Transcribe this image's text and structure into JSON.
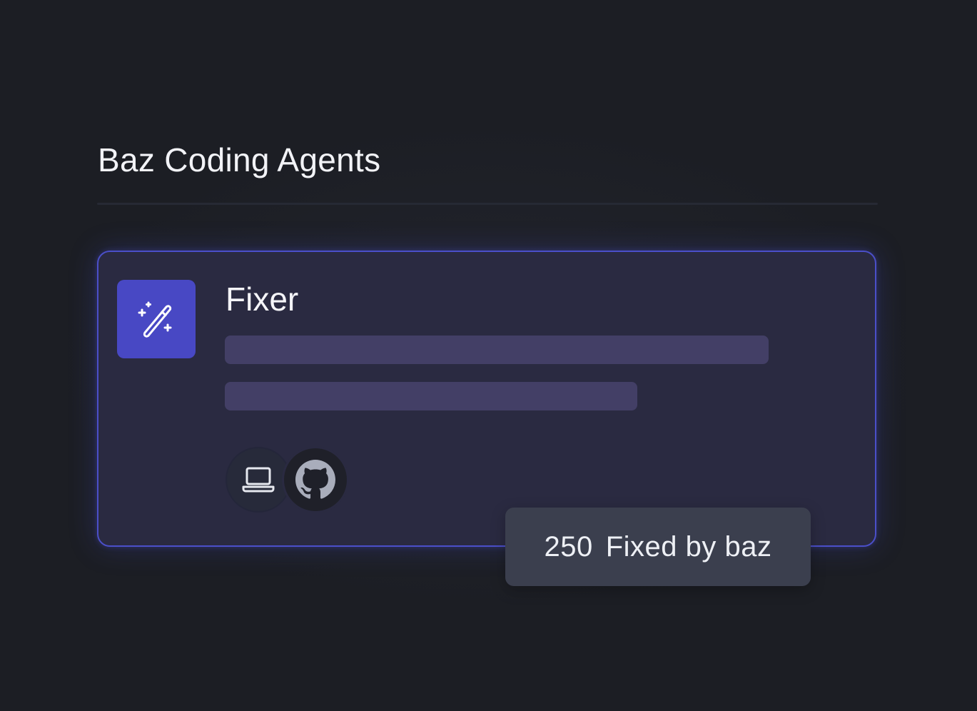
{
  "section": {
    "title": "Baz Coding Agents"
  },
  "agent": {
    "name": "Fixer",
    "icon": "magic-wand-icon",
    "accent_color": "#4848c4",
    "border_color": "#4b4fc9",
    "integrations": [
      {
        "name": "laptop-icon"
      },
      {
        "name": "github-icon"
      }
    ]
  },
  "stat": {
    "value": "250",
    "label": "Fixed by baz"
  }
}
